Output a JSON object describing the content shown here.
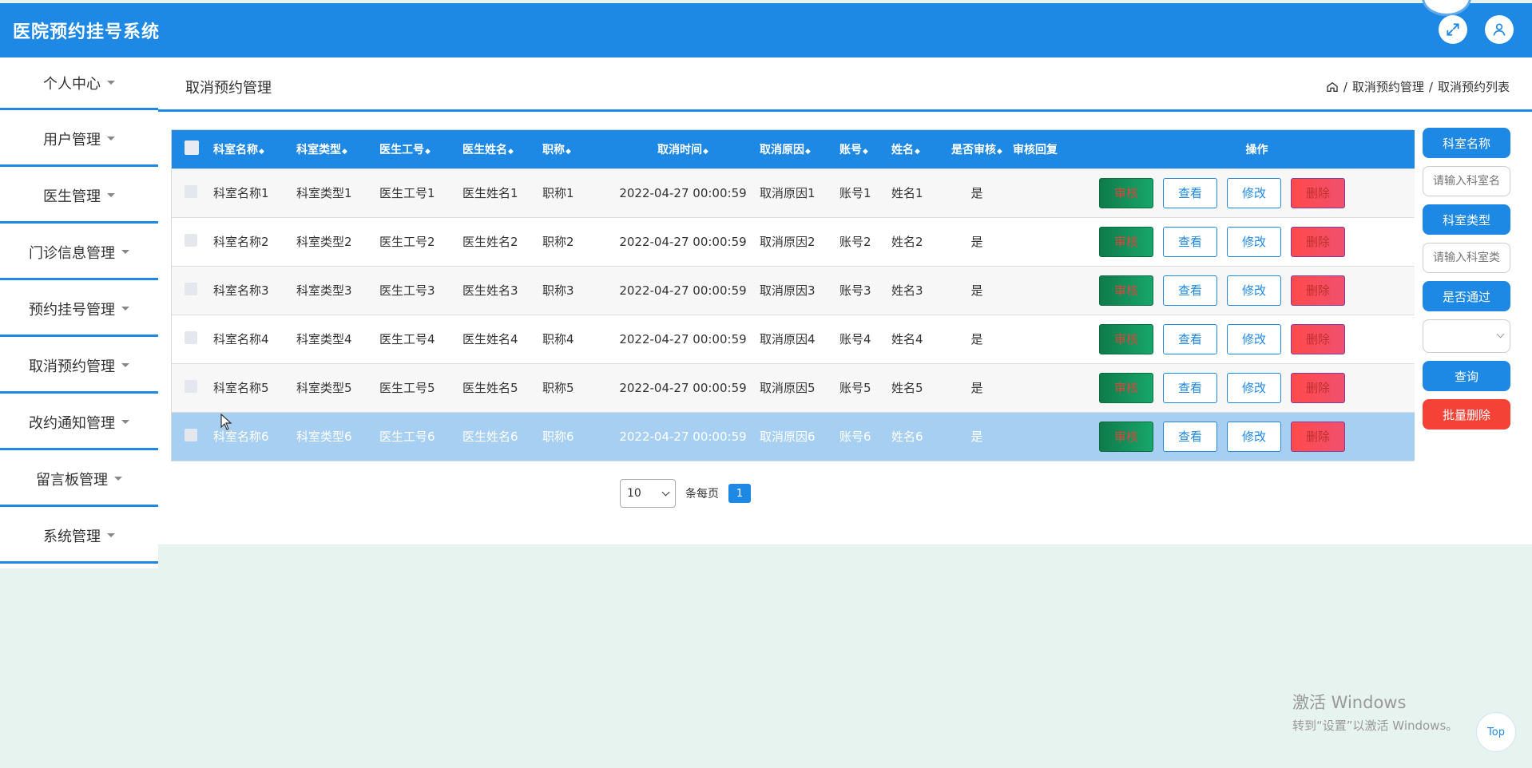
{
  "app": {
    "title": "医院预约挂号系统"
  },
  "colors": {
    "primary": "#1e88e5",
    "danger": "#f44336",
    "success": "#0f7a4a",
    "background": "#e7f3ee"
  },
  "header_icons": [
    {
      "name": "fullscreen-icon"
    },
    {
      "name": "user-icon"
    }
  ],
  "sidebar": {
    "items": [
      {
        "label": "个人中心"
      },
      {
        "label": "用户管理"
      },
      {
        "label": "医生管理"
      },
      {
        "label": "门诊信息管理"
      },
      {
        "label": "预约挂号管理"
      },
      {
        "label": "取消预约管理"
      },
      {
        "label": "改约通知管理"
      },
      {
        "label": "留言板管理"
      },
      {
        "label": "系统管理"
      }
    ]
  },
  "page": {
    "title": "取消预约管理",
    "breadcrumb": {
      "sep": "/",
      "items": [
        "取消预约管理",
        "取消预约列表"
      ]
    }
  },
  "table": {
    "columns": [
      "科室名称",
      "科室类型",
      "医生工号",
      "医生姓名",
      "职称",
      "取消时间",
      "取消原因",
      "账号",
      "姓名",
      "是否审核",
      "审核回复",
      "操作"
    ],
    "sort_glyph": "◆",
    "actions": {
      "review": "审核",
      "view": "查看",
      "edit": "修改",
      "delete": "删除"
    },
    "rows": [
      [
        "科室名称1",
        "科室类型1",
        "医生工号1",
        "医生姓名1",
        "职称1",
        "2022-04-27 00:00:59",
        "取消原因1",
        "账号1",
        "姓名1",
        "是",
        ""
      ],
      [
        "科室名称2",
        "科室类型2",
        "医生工号2",
        "医生姓名2",
        "职称2",
        "2022-04-27 00:00:59",
        "取消原因2",
        "账号2",
        "姓名2",
        "是",
        ""
      ],
      [
        "科室名称3",
        "科室类型3",
        "医生工号3",
        "医生姓名3",
        "职称3",
        "2022-04-27 00:00:59",
        "取消原因3",
        "账号3",
        "姓名3",
        "是",
        ""
      ],
      [
        "科室名称4",
        "科室类型4",
        "医生工号4",
        "医生姓名4",
        "职称4",
        "2022-04-27 00:00:59",
        "取消原因4",
        "账号4",
        "姓名4",
        "是",
        ""
      ],
      [
        "科室名称5",
        "科室类型5",
        "医生工号5",
        "医生姓名5",
        "职称5",
        "2022-04-27 00:00:59",
        "取消原因5",
        "账号5",
        "姓名5",
        "是",
        ""
      ],
      [
        "科室名称6",
        "科室类型6",
        "医生工号6",
        "医生姓名6",
        "职称6",
        "2022-04-27 00:00:59",
        "取消原因6",
        "账号6",
        "姓名6",
        "是",
        ""
      ]
    ]
  },
  "filters": {
    "dept_name_label": "科室名称",
    "dept_name_placeholder": "请输入科室名称",
    "dept_type_label": "科室类型",
    "dept_type_placeholder": "请输入科室类型",
    "passed_label": "是否通过",
    "passed_value": "",
    "query_button": "查询",
    "batch_delete_button": "批量删除"
  },
  "pagination": {
    "page_size": "10",
    "per_page_label": "条每页",
    "current_page": "1"
  },
  "watermark": {
    "line1": "激活 Windows",
    "line2": "转到“设置”以激活 Windows。"
  },
  "back_to_top": "Top"
}
